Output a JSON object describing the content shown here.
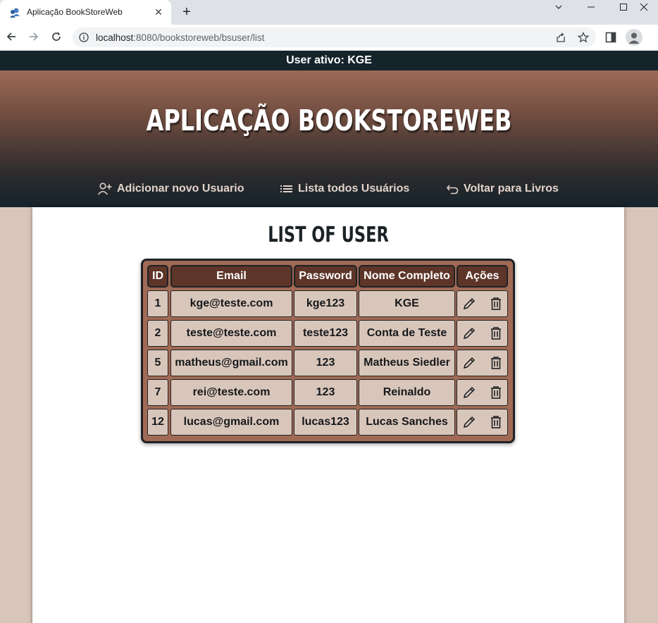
{
  "browser": {
    "tab_title": "Aplicação BookStoreWeb",
    "url_host": "localhost",
    "url_rest": ":8080/bookstoreweb/bsuser/list"
  },
  "page": {
    "user_bar": "User ativo: KGE",
    "app_title": "APLICAÇÃO BOOKSTOREWEB",
    "nav": {
      "add_user": "Adicionar novo Usuario",
      "list_users": "Lista todos Usuários",
      "back_books": "Voltar para Livros"
    },
    "list_title": "LIST OF USER"
  },
  "table": {
    "headers": [
      "ID",
      "Email",
      "Password",
      "Nome Completo",
      "Ações"
    ],
    "rows": [
      {
        "id": "1",
        "email": "kge@teste.com",
        "password": "kge123",
        "name": "KGE"
      },
      {
        "id": "2",
        "email": "teste@teste.com",
        "password": "teste123",
        "name": "Conta de Teste"
      },
      {
        "id": "5",
        "email": "matheus@gmail.com",
        "password": "123",
        "name": "Matheus Siedler"
      },
      {
        "id": "7",
        "email": "rei@teste.com",
        "password": "123",
        "name": "Reinaldo"
      },
      {
        "id": "12",
        "email": "lucas@gmail.com",
        "password": "lucas123",
        "name": "Lucas Sanches"
      }
    ]
  },
  "colors": {
    "top_bar": "#15232b",
    "header_cell": "#5e3529",
    "table_bg": "#a06a55",
    "cell_bg": "#d9c6bb"
  },
  "icons": {
    "row_actions": [
      "pencil-icon",
      "trash-icon"
    ]
  }
}
